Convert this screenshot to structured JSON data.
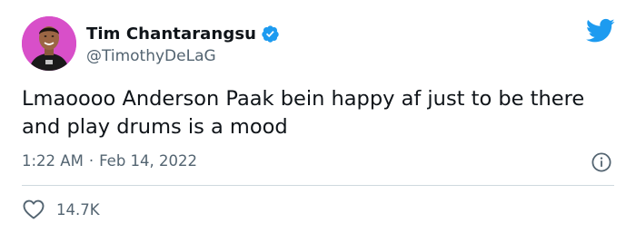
{
  "author": {
    "display_name": "Tim Chantarangsu",
    "handle": "@TimothyDeLaG",
    "verified": true,
    "avatar_icon": "user-avatar-photo"
  },
  "tweet": {
    "text": "Lmaoooo Anderson Paak bein happy af just to be there and play drums is a mood",
    "time": "1:22 AM",
    "separator": "·",
    "date": "Feb 14, 2022"
  },
  "engagement": {
    "likes": "14.7K",
    "like_icon": "heart-icon"
  },
  "icons": {
    "brand": "twitter-bird-icon",
    "verified": "verified-badge-icon",
    "info": "info-icon"
  },
  "colors": {
    "brand_blue": "#1d9bf0",
    "text_primary": "#0f1419",
    "text_secondary": "#536471",
    "divider": "#cfd9de",
    "avatar_bg": "#d84fc9"
  }
}
